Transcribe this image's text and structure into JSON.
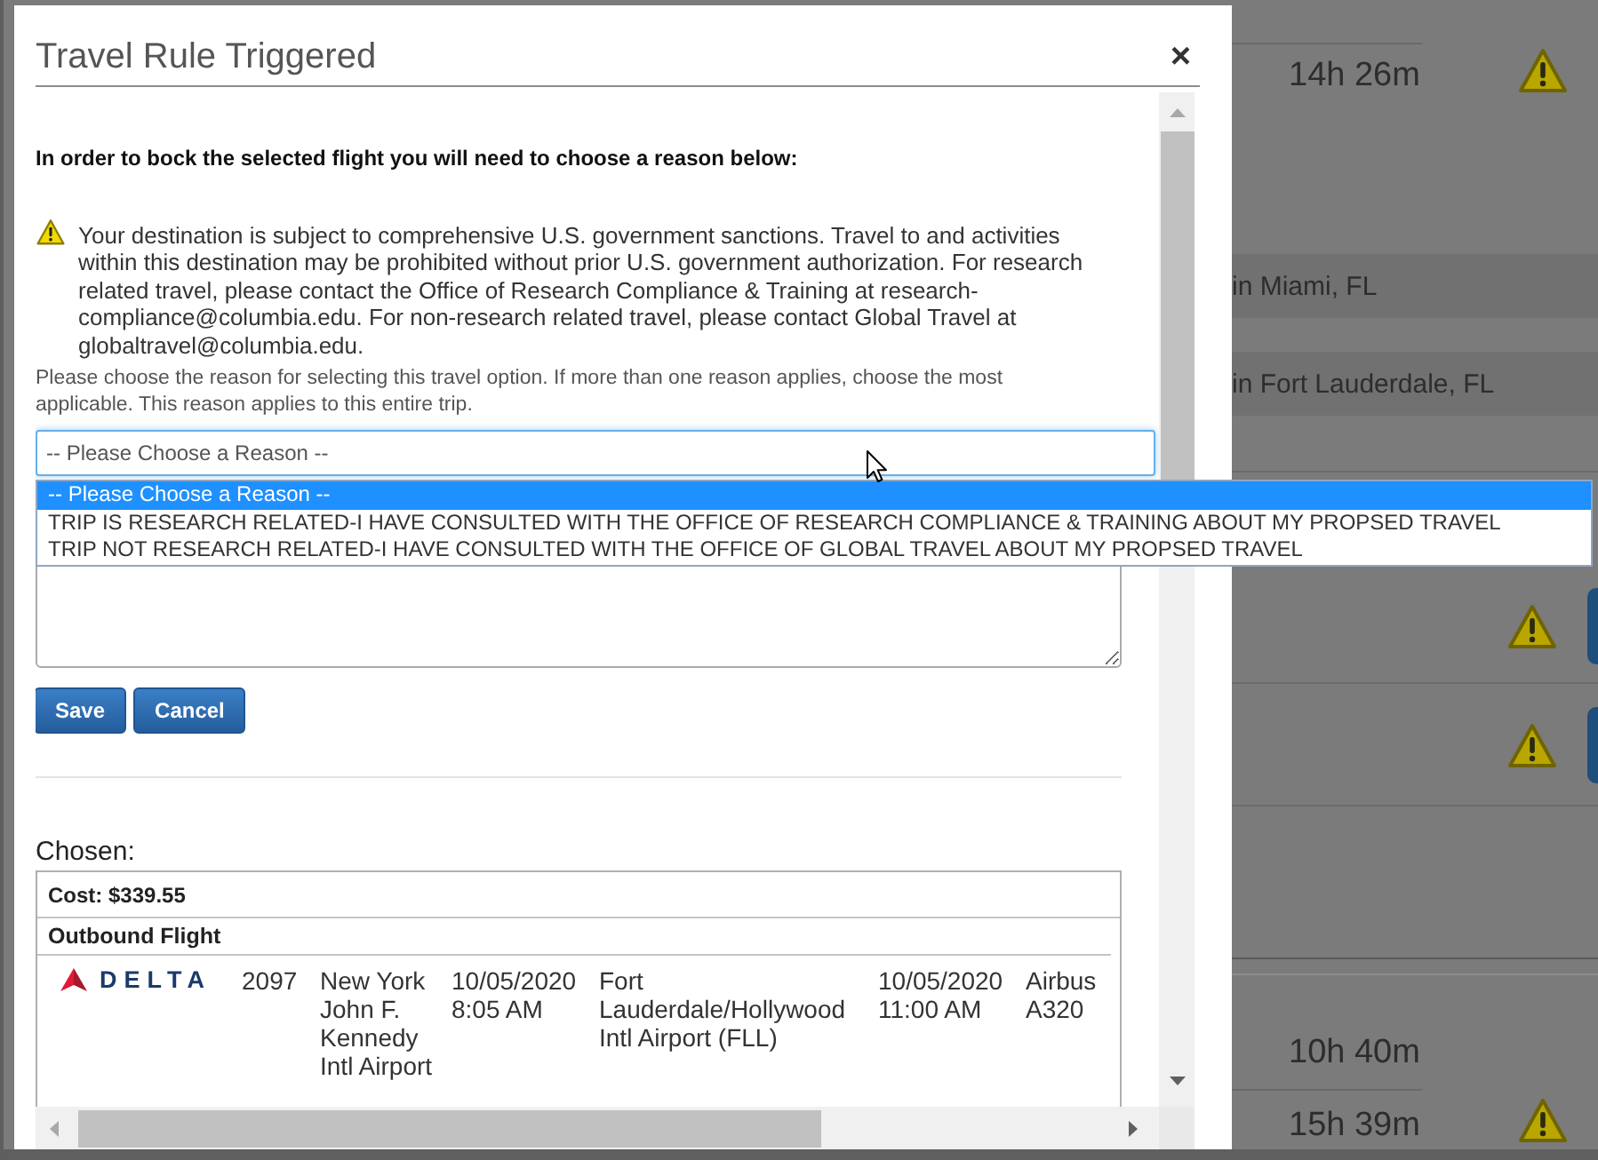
{
  "dialog": {
    "title": "Travel Rule Triggered",
    "close": "×"
  },
  "instruction": "In order to bock the selected flight you will need to choose a reason below:",
  "warning_message": "Your destination is subject to comprehensive U.S. government sanctions. Travel to and activities within this destination may be prohibited without prior U.S. government authorization. For research related travel, please contact the Office of Research Compliance & Training at research-compliance@columbia.edu. For non-research related travel, please contact Global Travel at globaltravel@columbia.edu.",
  "hint": "Please choose the reason for selecting this travel option. If more than one reason applies, choose the most applicable. This reason applies to this entire trip.",
  "reason_select": {
    "value": "-- Please Choose a Reason --",
    "expanded": true,
    "options": [
      {
        "label": "-- Please Choose a Reason --",
        "selected": true
      },
      {
        "label": "TRIP IS RESEARCH RELATED-I HAVE CONSULTED WITH THE OFFICE OF RESEARCH COMPLIANCE & TRAINING ABOUT MY PROPSED TRAVEL",
        "selected": false
      },
      {
        "label": "TRIP NOT RESEARCH RELATED-I HAVE CONSULTED WITH THE OFFICE OF GLOBAL TRAVEL ABOUT MY PROPSED TRAVEL",
        "selected": false
      }
    ]
  },
  "buttons": [
    "Save",
    "Cancel"
  ],
  "chosen": {
    "heading": "Chosen:",
    "cost": "Cost: $339.55",
    "segment": "Outbound Flight",
    "flight": {
      "airline_logo": "DELTA",
      "number": "2097",
      "departure_airport": "New York John F. Kennedy Intl Airport",
      "departure_time": "10/05/2020 8:05 AM",
      "arrival_airport": "Fort Lauderdale/Hollywood Intl Airport (FLL)",
      "arrival_time": "10/05/2020 11:00 AM",
      "aircraft": "Airbus A320"
    }
  },
  "background": {
    "top_durations": [
      {
        "duration": "14h 26m",
        "warning": true
      }
    ],
    "stops": [
      "in Miami, FL",
      "in Fort Lauderdale, FL"
    ],
    "actions": [
      {
        "warning": true
      },
      {
        "warning": true
      }
    ],
    "bottom_durations": [
      {
        "duration": "10h 40m",
        "warning": false
      },
      {
        "duration": "15h 39m",
        "warning": true
      }
    ]
  }
}
